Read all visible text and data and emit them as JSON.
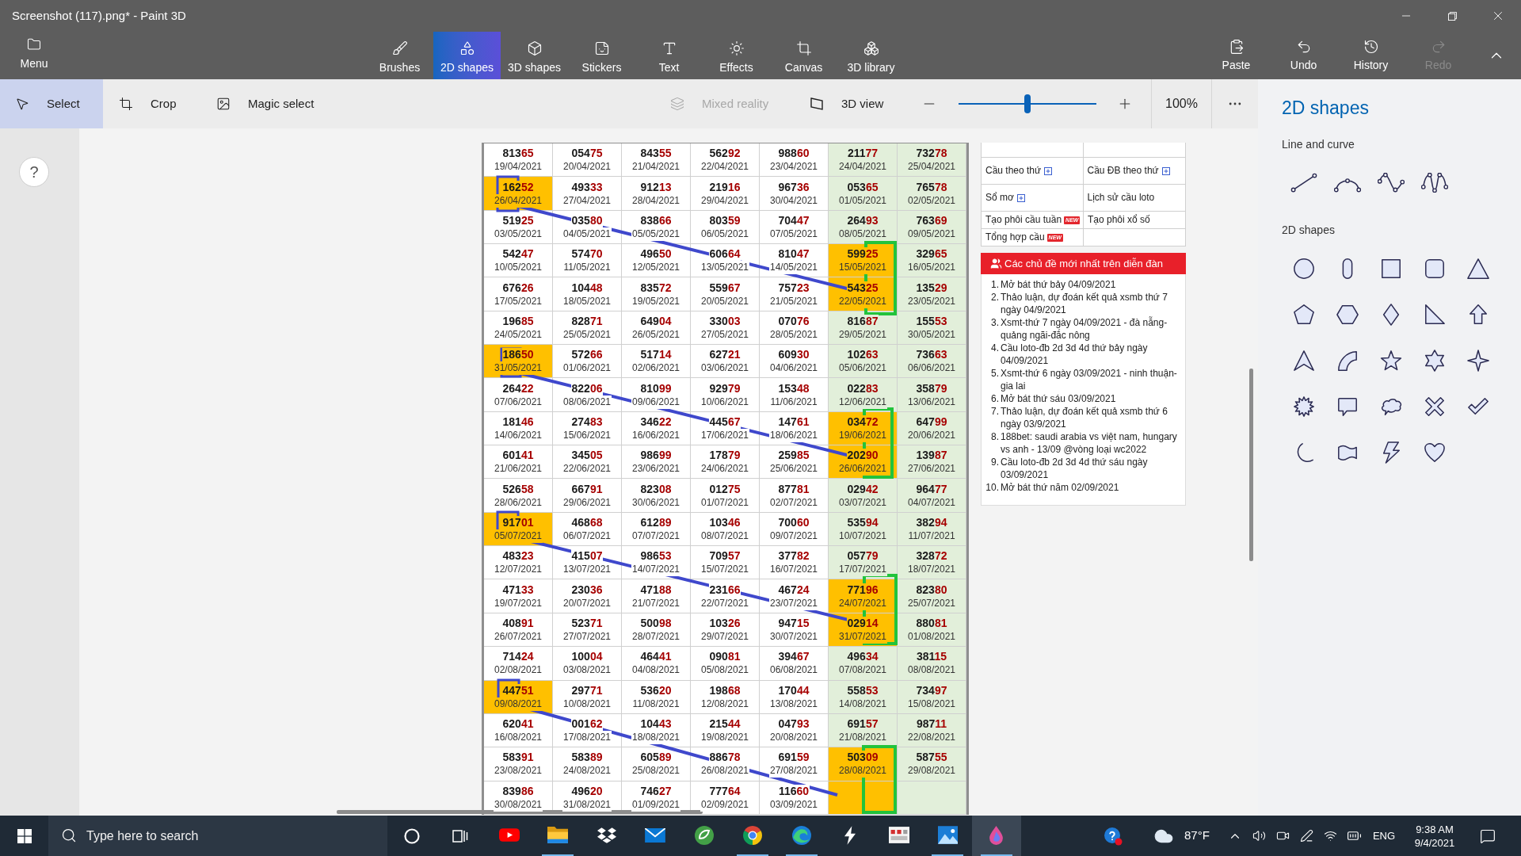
{
  "window": {
    "title": "Screenshot (117).png* - Paint 3D"
  },
  "menu": {
    "label": "Menu"
  },
  "tools": [
    {
      "label": "Brushes",
      "selected": false
    },
    {
      "label": "2D shapes",
      "selected": true
    },
    {
      "label": "3D shapes",
      "selected": false
    },
    {
      "label": "Stickers",
      "selected": false
    },
    {
      "label": "Text",
      "selected": false
    },
    {
      "label": "Effects",
      "selected": false
    },
    {
      "label": "Canvas",
      "selected": false
    },
    {
      "label": "3D library",
      "selected": false
    }
  ],
  "actions": [
    {
      "label": "Paste",
      "disabled": false
    },
    {
      "label": "Undo",
      "disabled": false
    },
    {
      "label": "History",
      "disabled": false
    },
    {
      "label": "Redo",
      "disabled": true
    }
  ],
  "subtools": [
    {
      "label": "Select",
      "selected": true
    },
    {
      "label": "Crop",
      "selected": false
    },
    {
      "label": "Magic select",
      "selected": false
    }
  ],
  "view": [
    {
      "label": "Mixed reality",
      "disabled": true
    },
    {
      "label": "3D view",
      "disabled": false
    }
  ],
  "zoom": {
    "level": 0.5,
    "reading": "100%"
  },
  "help": {
    "label": "?"
  },
  "canvas": {
    "table": {
      "columns": [
        {
          "shaded": false
        },
        {
          "shaded": false
        },
        {
          "shaded": false
        },
        {
          "shaded": false
        },
        {
          "shaded": false
        },
        {
          "shaded": true
        },
        {
          "shaded": true
        }
      ],
      "rows": [
        [
          {
            "number": "81365",
            "date": "19/04/2021",
            "highlighted": false
          },
          {
            "number": "05475",
            "date": "20/04/2021",
            "highlighted": false
          },
          {
            "number": "84355",
            "date": "21/04/2021",
            "highlighted": false
          },
          {
            "number": "56292",
            "date": "22/04/2021",
            "highlighted": false
          },
          {
            "number": "98860",
            "date": "23/04/2021",
            "highlighted": false
          },
          {
            "number": "21177",
            "date": "24/04/2021",
            "highlighted": false
          },
          {
            "number": "73278",
            "date": "25/04/2021",
            "highlighted": false
          }
        ],
        [
          {
            "number": "16252",
            "date": "26/04/2021",
            "highlighted": true
          },
          {
            "number": "49333",
            "date": "27/04/2021",
            "highlighted": false
          },
          {
            "number": "91213",
            "date": "28/04/2021",
            "highlighted": false
          },
          {
            "number": "21916",
            "date": "29/04/2021",
            "highlighted": false
          },
          {
            "number": "96736",
            "date": "30/04/2021",
            "highlighted": false
          },
          {
            "number": "05365",
            "date": "01/05/2021",
            "highlighted": false
          },
          {
            "number": "76578",
            "date": "02/05/2021",
            "highlighted": false
          }
        ],
        [
          {
            "number": "51925",
            "date": "03/05/2021",
            "highlighted": false
          },
          {
            "number": "03580",
            "date": "04/05/2021",
            "highlighted": false
          },
          {
            "number": "83866",
            "date": "05/05/2021",
            "highlighted": false
          },
          {
            "number": "80359",
            "date": "06/05/2021",
            "highlighted": false
          },
          {
            "number": "70447",
            "date": "07/05/2021",
            "highlighted": false
          },
          {
            "number": "26493",
            "date": "08/05/2021",
            "highlighted": false
          },
          {
            "number": "76369",
            "date": "09/05/2021",
            "highlighted": false
          }
        ],
        [
          {
            "number": "54247",
            "date": "10/05/2021",
            "highlighted": false
          },
          {
            "number": "57470",
            "date": "11/05/2021",
            "highlighted": false
          },
          {
            "number": "49650",
            "date": "12/05/2021",
            "highlighted": false
          },
          {
            "number": "60664",
            "date": "13/05/2021",
            "highlighted": false
          },
          {
            "number": "81047",
            "date": "14/05/2021",
            "highlighted": false
          },
          {
            "number": "59925",
            "date": "15/05/2021",
            "highlighted": true
          },
          {
            "number": "32965",
            "date": "16/05/2021",
            "highlighted": false
          }
        ],
        [
          {
            "number": "67626",
            "date": "17/05/2021",
            "highlighted": false
          },
          {
            "number": "10448",
            "date": "18/05/2021",
            "highlighted": false
          },
          {
            "number": "83572",
            "date": "19/05/2021",
            "highlighted": false
          },
          {
            "number": "55967",
            "date": "20/05/2021",
            "highlighted": false
          },
          {
            "number": "75723",
            "date": "21/05/2021",
            "highlighted": false
          },
          {
            "number": "54325",
            "date": "22/05/2021",
            "highlighted": true
          },
          {
            "number": "13529",
            "date": "23/05/2021",
            "highlighted": false
          }
        ],
        [
          {
            "number": "19685",
            "date": "24/05/2021",
            "highlighted": false
          },
          {
            "number": "82871",
            "date": "25/05/2021",
            "highlighted": false
          },
          {
            "number": "64904",
            "date": "26/05/2021",
            "highlighted": false
          },
          {
            "number": "33003",
            "date": "27/05/2021",
            "highlighted": false
          },
          {
            "number": "07076",
            "date": "28/05/2021",
            "highlighted": false
          },
          {
            "number": "81687",
            "date": "29/05/2021",
            "highlighted": false
          },
          {
            "number": "15553",
            "date": "30/05/2021",
            "highlighted": false
          }
        ],
        [
          {
            "number": "18650",
            "date": "31/05/2021",
            "highlighted": true
          },
          {
            "number": "57266",
            "date": "01/06/2021",
            "highlighted": false
          },
          {
            "number": "51714",
            "date": "02/06/2021",
            "highlighted": false
          },
          {
            "number": "62721",
            "date": "03/06/2021",
            "highlighted": false
          },
          {
            "number": "60930",
            "date": "04/06/2021",
            "highlighted": false
          },
          {
            "number": "10263",
            "date": "05/06/2021",
            "highlighted": false
          },
          {
            "number": "73663",
            "date": "06/06/2021",
            "highlighted": false
          }
        ],
        [
          {
            "number": "26422",
            "date": "07/06/2021",
            "highlighted": false
          },
          {
            "number": "82206",
            "date": "08/06/2021",
            "highlighted": false
          },
          {
            "number": "81099",
            "date": "09/06/2021",
            "highlighted": false
          },
          {
            "number": "92979",
            "date": "10/06/2021",
            "highlighted": false
          },
          {
            "number": "15348",
            "date": "11/06/2021",
            "highlighted": false
          },
          {
            "number": "02283",
            "date": "12/06/2021",
            "highlighted": false
          },
          {
            "number": "35879",
            "date": "13/06/2021",
            "highlighted": false
          }
        ],
        [
          {
            "number": "18146",
            "date": "14/06/2021",
            "highlighted": false
          },
          {
            "number": "27483",
            "date": "15/06/2021",
            "highlighted": false
          },
          {
            "number": "34622",
            "date": "16/06/2021",
            "highlighted": false
          },
          {
            "number": "44567",
            "date": "17/06/2021",
            "highlighted": false
          },
          {
            "number": "14761",
            "date": "18/06/2021",
            "highlighted": false
          },
          {
            "number": "03472",
            "date": "19/06/2021",
            "highlighted": true
          },
          {
            "number": "64799",
            "date": "20/06/2021",
            "highlighted": false
          }
        ],
        [
          {
            "number": "60141",
            "date": "21/06/2021",
            "highlighted": false
          },
          {
            "number": "34505",
            "date": "22/06/2021",
            "highlighted": false
          },
          {
            "number": "98699",
            "date": "23/06/2021",
            "highlighted": false
          },
          {
            "number": "17879",
            "date": "24/06/2021",
            "highlighted": false
          },
          {
            "number": "25985",
            "date": "25/06/2021",
            "highlighted": false
          },
          {
            "number": "20290",
            "date": "26/06/2021",
            "highlighted": true
          },
          {
            "number": "13987",
            "date": "27/06/2021",
            "highlighted": false
          }
        ],
        [
          {
            "number": "52658",
            "date": "28/06/2021",
            "highlighted": false
          },
          {
            "number": "66791",
            "date": "29/06/2021",
            "highlighted": false
          },
          {
            "number": "82308",
            "date": "30/06/2021",
            "highlighted": false
          },
          {
            "number": "01275",
            "date": "01/07/2021",
            "highlighted": false
          },
          {
            "number": "87781",
            "date": "02/07/2021",
            "highlighted": false
          },
          {
            "number": "02942",
            "date": "03/07/2021",
            "highlighted": false
          },
          {
            "number": "96477",
            "date": "04/07/2021",
            "highlighted": false
          }
        ],
        [
          {
            "number": "91701",
            "date": "05/07/2021",
            "highlighted": true
          },
          {
            "number": "46868",
            "date": "06/07/2021",
            "highlighted": false
          },
          {
            "number": "61289",
            "date": "07/07/2021",
            "highlighted": false
          },
          {
            "number": "10346",
            "date": "08/07/2021",
            "highlighted": false
          },
          {
            "number": "70060",
            "date": "09/07/2021",
            "highlighted": false
          },
          {
            "number": "53594",
            "date": "10/07/2021",
            "highlighted": false
          },
          {
            "number": "38294",
            "date": "11/07/2021",
            "highlighted": false
          }
        ],
        [
          {
            "number": "48323",
            "date": "12/07/2021",
            "highlighted": false
          },
          {
            "number": "41507",
            "date": "13/07/2021",
            "highlighted": false
          },
          {
            "number": "98653",
            "date": "14/07/2021",
            "highlighted": false
          },
          {
            "number": "70957",
            "date": "15/07/2021",
            "highlighted": false
          },
          {
            "number": "37782",
            "date": "16/07/2021",
            "highlighted": false
          },
          {
            "number": "05779",
            "date": "17/07/2021",
            "highlighted": false
          },
          {
            "number": "32872",
            "date": "18/07/2021",
            "highlighted": false
          }
        ],
        [
          {
            "number": "47133",
            "date": "19/07/2021",
            "highlighted": false
          },
          {
            "number": "23036",
            "date": "20/07/2021",
            "highlighted": false
          },
          {
            "number": "47188",
            "date": "21/07/2021",
            "highlighted": false
          },
          {
            "number": "23166",
            "date": "22/07/2021",
            "highlighted": false
          },
          {
            "number": "46724",
            "date": "23/07/2021",
            "highlighted": false
          },
          {
            "number": "77196",
            "date": "24/07/2021",
            "highlighted": true
          },
          {
            "number": "82380",
            "date": "25/07/2021",
            "highlighted": false
          }
        ],
        [
          {
            "number": "40891",
            "date": "26/07/2021",
            "highlighted": false
          },
          {
            "number": "52371",
            "date": "27/07/2021",
            "highlighted": false
          },
          {
            "number": "50098",
            "date": "28/07/2021",
            "highlighted": false
          },
          {
            "number": "10326",
            "date": "29/07/2021",
            "highlighted": false
          },
          {
            "number": "94715",
            "date": "30/07/2021",
            "highlighted": false
          },
          {
            "number": "02914",
            "date": "31/07/2021",
            "highlighted": true
          },
          {
            "number": "88081",
            "date": "01/08/2021",
            "highlighted": false
          }
        ],
        [
          {
            "number": "71424",
            "date": "02/08/2021",
            "highlighted": false
          },
          {
            "number": "10004",
            "date": "03/08/2021",
            "highlighted": false
          },
          {
            "number": "46441",
            "date": "04/08/2021",
            "highlighted": false
          },
          {
            "number": "09081",
            "date": "05/08/2021",
            "highlighted": false
          },
          {
            "number": "39467",
            "date": "06/08/2021",
            "highlighted": false
          },
          {
            "number": "49634",
            "date": "07/08/2021",
            "highlighted": false
          },
          {
            "number": "38115",
            "date": "08/08/2021",
            "highlighted": false
          }
        ],
        [
          {
            "number": "44751",
            "date": "09/08/2021",
            "highlighted": true
          },
          {
            "number": "29771",
            "date": "10/08/2021",
            "highlighted": false
          },
          {
            "number": "53620",
            "date": "11/08/2021",
            "highlighted": false
          },
          {
            "number": "19868",
            "date": "12/08/2021",
            "highlighted": false
          },
          {
            "number": "17044",
            "date": "13/08/2021",
            "highlighted": false
          },
          {
            "number": "55853",
            "date": "14/08/2021",
            "highlighted": false
          },
          {
            "number": "73497",
            "date": "15/08/2021",
            "highlighted": false
          }
        ],
        [
          {
            "number": "62041",
            "date": "16/08/2021",
            "highlighted": false
          },
          {
            "number": "00162",
            "date": "17/08/2021",
            "highlighted": false
          },
          {
            "number": "10443",
            "date": "18/08/2021",
            "highlighted": false
          },
          {
            "number": "21544",
            "date": "19/08/2021",
            "highlighted": false
          },
          {
            "number": "04793",
            "date": "20/08/2021",
            "highlighted": false
          },
          {
            "number": "69157",
            "date": "21/08/2021",
            "highlighted": false
          },
          {
            "number": "98711",
            "date": "22/08/2021",
            "highlighted": false
          }
        ],
        [
          {
            "number": "58391",
            "date": "23/08/2021",
            "highlighted": false
          },
          {
            "number": "58389",
            "date": "24/08/2021",
            "highlighted": false
          },
          {
            "number": "60589",
            "date": "25/08/2021",
            "highlighted": false
          },
          {
            "number": "88678",
            "date": "26/08/2021",
            "highlighted": false
          },
          {
            "number": "69159",
            "date": "27/08/2021",
            "highlighted": false
          },
          {
            "number": "50309",
            "date": "28/08/2021",
            "highlighted": true
          },
          {
            "number": "58755",
            "date": "29/08/2021",
            "highlighted": false
          }
        ],
        [
          {
            "number": "83986",
            "date": "30/08/2021",
            "highlighted": false
          },
          {
            "number": "49620",
            "date": "31/08/2021",
            "highlighted": false
          },
          {
            "number": "74627",
            "date": "01/09/2021",
            "highlighted": false
          },
          {
            "number": "77764",
            "date": "02/09/2021",
            "highlighted": false
          },
          {
            "number": "11660",
            "date": "03/09/2021",
            "highlighted": false
          },
          {
            "highlighted": true
          },
          {
            "highlighted": false
          }
        ]
      ]
    },
    "links": {
      "rows": [
        [
          {
            "text": "Cầu theo thứ",
            "expandable": true
          },
          {
            "text": "Cầu ĐB theo thứ",
            "expandable": true
          }
        ],
        [
          {
            "text": "Sổ mơ",
            "expandable": true
          },
          {
            "text": "Lịch sử cầu loto",
            "expandable": false
          }
        ],
        [
          {
            "text": "Tạo phôi cầu tuần",
            "expandable": false,
            "badge": "NEW"
          },
          {
            "text": "Tạo phôi xổ số",
            "expandable": false
          }
        ],
        [
          {
            "text": "Tổng hợp cầu",
            "expandable": false,
            "badge": "NEW"
          }
        ]
      ]
    },
    "forum": {
      "title": "Các chủ đề mới nhất trên diễn đàn",
      "items": [
        {
          "marker": "1.",
          "text": "Mở bát thứ bảy 04/09/2021"
        },
        {
          "marker": "2.",
          "text": "Thảo luận, dự đoán kết quả xsmb thứ 7 ngày 04/9/2021"
        },
        {
          "marker": "3.",
          "text": "Xsmt-thứ 7 ngày 04/09/2021 - đà nẵng-quảng ngãi-đắc nông"
        },
        {
          "marker": "4.",
          "text": "Cầu loto-đb 2d 3d 4d thứ bảy ngày 04/09/2021"
        },
        {
          "marker": "5.",
          "text": "Xsmt-thứ 6 ngày 03/09/2021 - ninh thuận-gia lai"
        },
        {
          "marker": "6.",
          "text": "Mở bát thứ sáu 03/09/2021"
        },
        {
          "marker": "7.",
          "text": "Thảo luận, dự đoán kết quả xsmb thứ 6 ngày 03/9/2021"
        },
        {
          "marker": "8.",
          "text": "188bet: saudi arabia vs việt nam, hungary vs anh - 13/09 @vòng loại wc2022"
        },
        {
          "marker": "9.",
          "text": "Cầu loto-đb 2d 3d 4d thứ sáu ngày 03/09/2021"
        },
        {
          "marker": "10.",
          "text": "Mở bát thứ năm 02/09/2021"
        }
      ]
    }
  },
  "panel": {
    "title": "2D shapes",
    "sections": [
      {
        "title": "Line and curve"
      },
      {
        "title": "2D shapes"
      }
    ]
  },
  "taskbar": {
    "search": {
      "placeholder": "Type here to search"
    },
    "apps": [
      {
        "running": false,
        "selected": false
      },
      {
        "running": true,
        "selected": false
      },
      {
        "running": false,
        "selected": false
      },
      {
        "running": false,
        "selected": false
      },
      {
        "running": false,
        "selected": false
      },
      {
        "running": true,
        "selected": false
      },
      {
        "running": true,
        "selected": false
      },
      {
        "running": false,
        "selected": false
      },
      {
        "running": false,
        "selected": false
      },
      {
        "running": true,
        "selected": false
      },
      {
        "running": true,
        "selected": true
      }
    ],
    "weather": "87°F",
    "language": "ENG",
    "time": "9:38 AM",
    "date": "9/4/2021"
  }
}
